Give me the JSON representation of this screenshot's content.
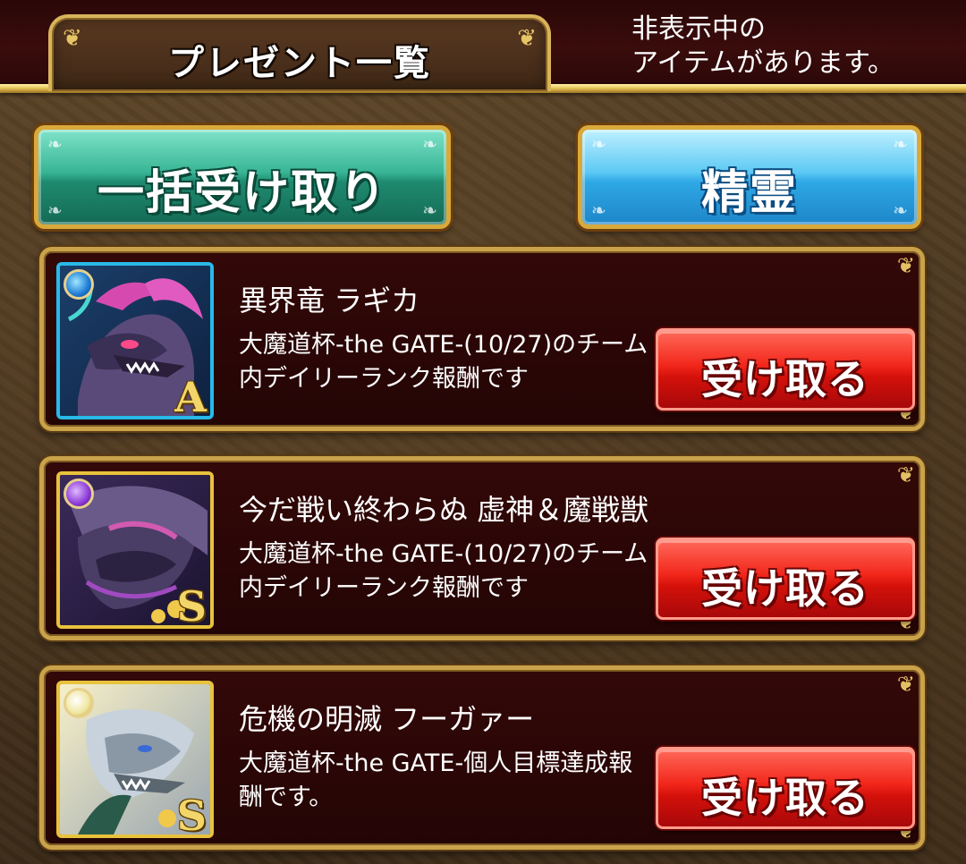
{
  "header": {
    "title": "プレゼント一覧",
    "hidden_notice_line1": "非表示中の",
    "hidden_notice_line2": "アイテムがあります。"
  },
  "actions": {
    "bulk_receive_label": "一括受け取り",
    "spirit_label": "精霊"
  },
  "rewards": [
    {
      "name": "異界竜 ラギカ",
      "description": "大魔道杯-the GATE-(10/27)のチーム内デイリーランク報酬です",
      "rank": "A",
      "element": "water",
      "frame_color": "#28b9e8",
      "receive_label": "受け取る"
    },
    {
      "name": "今だ戦い終わらぬ 虚神＆魔戦獣",
      "description": "大魔道杯-the GATE-(10/27)のチーム内デイリーランク報酬です",
      "rank": "S",
      "element": "dark",
      "frame_color": "#e8c23c",
      "receive_label": "受け取る"
    },
    {
      "name": "危機の明滅 フーガァー",
      "description": "大魔道杯-the GATE-個人目標達成報酬です。",
      "rank": "S",
      "element": "light",
      "frame_color": "#e8c23c",
      "receive_label": "受け取る"
    }
  ],
  "colors": {
    "header_band": "#3a0c0c",
    "gold_border": "#c9a24a",
    "bulk_button": "#38b595",
    "spirit_button": "#5cc9f4",
    "receive_button": "#f2261b",
    "card_background": "#2a0606"
  },
  "icons": {
    "ornament": "gold-scroll-ornament",
    "water_orb": "water-element-icon",
    "dark_orb": "dark-element-icon",
    "light_orb": "light-element-icon"
  }
}
